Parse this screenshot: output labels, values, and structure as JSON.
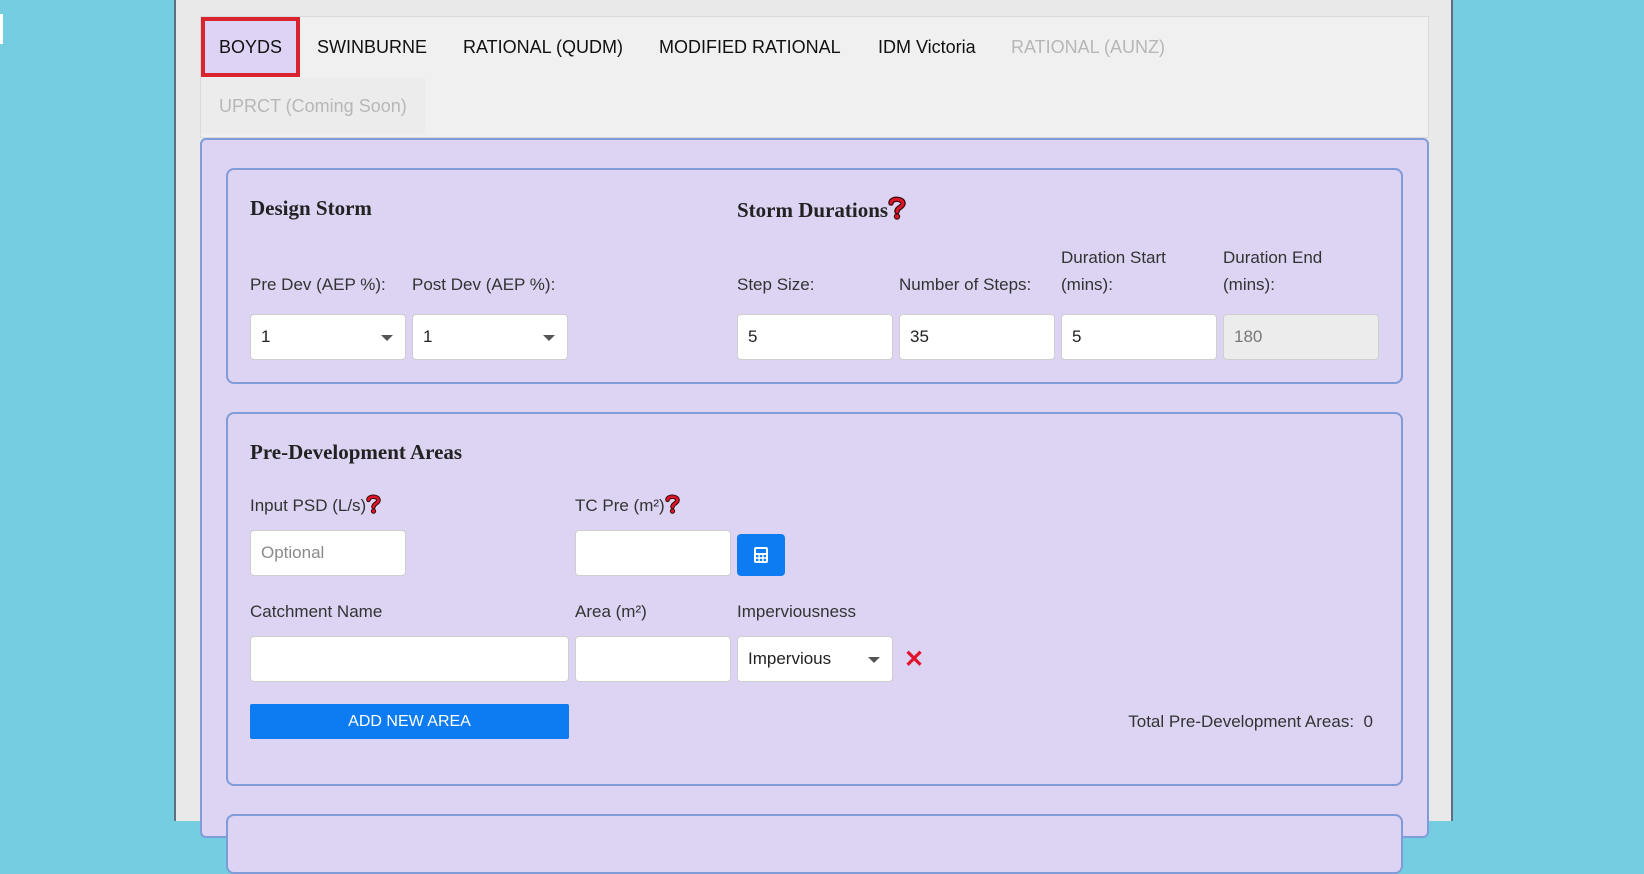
{
  "tabs": [
    {
      "label": "BOYDS",
      "active": true,
      "disabled": false
    },
    {
      "label": "SWINBURNE",
      "active": false,
      "disabled": false
    },
    {
      "label": "RATIONAL (QUDM)",
      "active": false,
      "disabled": false
    },
    {
      "label": "MODIFIED RATIONAL",
      "active": false,
      "disabled": false
    },
    {
      "label": "IDM Victoria",
      "active": false,
      "disabled": false
    },
    {
      "label": "RATIONAL (AUNZ)",
      "active": false,
      "disabled": true
    },
    {
      "label": "UPRCT (Coming Soon)",
      "active": false,
      "disabled": true
    }
  ],
  "design_storm": {
    "title": "Design Storm",
    "pre_dev_label": "Pre Dev (AEP %):",
    "pre_dev_value": "1",
    "post_dev_label": "Post Dev (AEP %):",
    "post_dev_value": "1"
  },
  "storm_durations": {
    "title": "Storm Durations",
    "step_size_label": "Step Size:",
    "step_size_value": "5",
    "num_steps_label": "Number of Steps:",
    "num_steps_value": "35",
    "duration_start_label_1": "Duration Start",
    "duration_start_label_2": "(mins):",
    "duration_start_value": "5",
    "duration_end_label_1": "Duration End",
    "duration_end_label_2": "(mins):",
    "duration_end_value": "180"
  },
  "pre_dev_areas": {
    "title": "Pre-Development Areas",
    "input_psd_label": "Input PSD (L/s)",
    "input_psd_placeholder": "Optional",
    "tc_pre_label": "TC Pre (m²)",
    "tc_pre_value": "",
    "catchment_name_label": "Catchment Name",
    "catchment_name_value": "",
    "area_label": "Area (m²)",
    "area_value": "",
    "imperviousness_label": "Imperviousness",
    "imperviousness_value": "Impervious",
    "remove_glyph": "✕",
    "add_button_label": "ADD NEW AREA",
    "total_label": "Total Pre-Development Areas:",
    "total_value": "0"
  },
  "colors": {
    "background": "#74cde0",
    "panel": "#ddd3f3",
    "card_border": "#7f9bd8",
    "active_tab_outline": "#d9232e",
    "button_blue": "#0d7bf2",
    "help_icon": "#e0152b"
  },
  "icons": {
    "help": "question-mark-icon",
    "calculator": "calculator-icon",
    "remove": "close-icon",
    "dropdown": "chevron-down-icon"
  }
}
